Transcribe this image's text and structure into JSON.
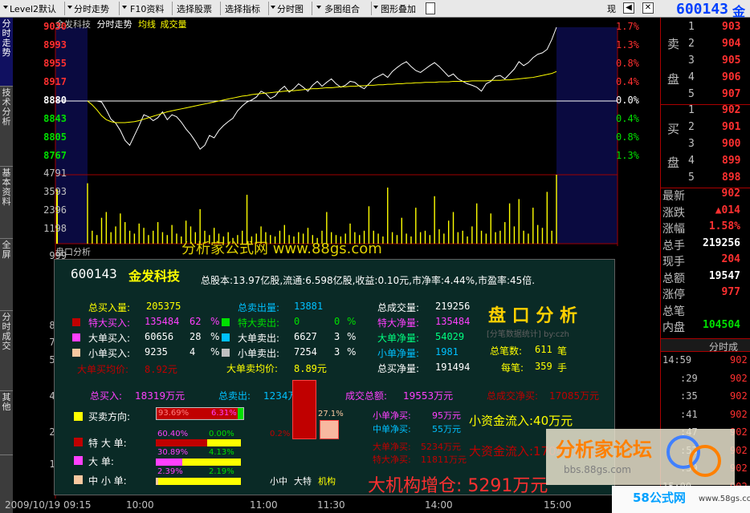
{
  "menubar": {
    "items": [
      "Level2默认",
      "分时走势",
      "F10资料",
      "选择股票",
      "选择指标",
      "分时图",
      "多图组合",
      "图形叠加"
    ],
    "right_item": "现",
    "stock_code": "600143",
    "stock_name_short": "金"
  },
  "left_tabs": [
    "分时走势",
    "技术分析",
    "基本资料",
    "全屏",
    "分时成交",
    "其他"
  ],
  "chart_header": {
    "name": "金发科技",
    "mode": "分时走势",
    "avg": "均线",
    "vol": "成交量"
  },
  "price_axis": {
    "upper": [
      "9030",
      "8993",
      "8955",
      "8917"
    ],
    "mid": "8880",
    "lower": [
      "8843",
      "8805",
      "8767"
    ],
    "pct_up": [
      "1.7%",
      "1.3%",
      "0.8%",
      "0.4%"
    ],
    "pct_mid": "0.0%",
    "pct_down": [
      "0.4%",
      "0.8%",
      "1.3%"
    ],
    "colors": {
      "up": "#ff3030",
      "down": "#00e000",
      "mid": "#ffffff"
    }
  },
  "volume_axis": [
    "4791",
    "3593",
    "2396",
    "1198"
  ],
  "lower_axis": [
    "999",
    "857",
    "714",
    "571",
    "428",
    "286",
    "143"
  ],
  "lower_title": "盘口分析",
  "time_axis": [
    "2009/10/19  09:15",
    "10:00",
    "11:00",
    "11:30",
    "14:00",
    "15:00"
  ],
  "watermark_top": "分析家公式网 www.88gs.com",
  "popup": {
    "code": "600143",
    "name": "金发科技",
    "info": "总股本:13.97亿股,流通:6.598亿股,收益:0.10元,市净率:4.44%,市盈率:45倍.",
    "col1": {
      "total_buy_label": "总买入量:",
      "total_buy": "205375",
      "rows": [
        {
          "label": "特大买入:",
          "value": "135484",
          "pct": "62",
          "unit": "%"
        },
        {
          "label": "大单买入:",
          "value": "60656",
          "pct": "28",
          "unit": "%"
        },
        {
          "label": "小单买入:",
          "value": "9235",
          "pct": "4",
          "unit": "%"
        }
      ],
      "avg_label": "大单买均价:",
      "avg": "8.92元"
    },
    "col2": {
      "total_sell_label": "总卖出量:",
      "total_sell": "13881",
      "rows": [
        {
          "label": "特大卖出:",
          "value": "0",
          "pct": "0",
          "unit": "%"
        },
        {
          "label": "大单卖出:",
          "value": "6627",
          "pct": "3",
          "unit": "%"
        },
        {
          "label": "小单卖出:",
          "value": "7254",
          "pct": "3",
          "unit": "%"
        }
      ],
      "avg_label": "大单卖均价:",
      "avg": "8.89元"
    },
    "col3": {
      "rows": [
        {
          "label": "总成交量:",
          "value": "219256"
        },
        {
          "label": "特大净量:",
          "value": "135484"
        },
        {
          "label": "大单净量:",
          "value": "54029"
        },
        {
          "label": "小单净量:",
          "value": "1981"
        },
        {
          "label": "总买净量:",
          "value": "191494"
        }
      ]
    },
    "analysis": {
      "title": "盘 口 分 析",
      "subtitle": "[分笔数据统计] by:czh",
      "count_label": "总笔数:",
      "count": "611",
      "count_unit": "笔",
      "per_label": "每笔:",
      "per": "359",
      "per_unit": "手"
    },
    "money": {
      "buy_label": "总买入:",
      "buy": "18319万元",
      "sell_label": "总卖出:",
      "sell": "1234万元",
      "total_label": "成交总额:",
      "total": "19553万元",
      "net_label": "总成交净买:",
      "net": "17085万元"
    },
    "bars": [
      {
        "label": "买卖方向:",
        "buy_pct": "93.69%",
        "sell_pct": "6.31%",
        "buy_frac": 0.9369,
        "color": "#ffff00"
      },
      {
        "label": "特 大 单:",
        "buy_pct": "60.40%",
        "sell_pct": "0.00%",
        "buy_frac": 0.604,
        "color": "#c00000"
      },
      {
        "label": "大    单:",
        "buy_pct": "30.89%",
        "sell_pct": "4.13%",
        "buy_frac": 0.3089,
        "color": "#ff40ff"
      },
      {
        "label": "中 小 单:",
        "buy_pct": "2.39%",
        "sell_pct": "2.19%",
        "buy_frac": 0.0239,
        "color": "#f8c8a0"
      }
    ],
    "bigbar": {
      "left_pct": "0.2%",
      "right_pct": "27.1%",
      "left_frac": 0.95,
      "right_frac": 0.271
    },
    "legend": {
      "a": "小中",
      "b": "大特",
      "c": "机构"
    },
    "net": [
      {
        "label": "小单净买:",
        "value": "95万元"
      },
      {
        "label": "中单净买:",
        "value": "55万元"
      },
      {
        "label": "大单净买:",
        "value": "5234万元"
      },
      {
        "label": "特大净买:",
        "value": "11811万元"
      }
    ],
    "small_flow": "小资金流入:40万元",
    "big_flow": "大资金流入:17045万元",
    "inst": "大机构增仓: 5291万元"
  },
  "right_panel": {
    "sell_label": [
      "卖",
      "盘"
    ],
    "buy_label": [
      "买",
      "盘"
    ],
    "sell": [
      {
        "lvl": "5",
        "price": "907"
      },
      {
        "lvl": "4",
        "price": "906"
      },
      {
        "lvl": "3",
        "price": "905"
      },
      {
        "lvl": "2",
        "price": "904"
      },
      {
        "lvl": "1",
        "price": "903"
      }
    ],
    "buy": [
      {
        "lvl": "1",
        "price": "902"
      },
      {
        "lvl": "2",
        "price": "901"
      },
      {
        "lvl": "3",
        "price": "900"
      },
      {
        "lvl": "4",
        "price": "899"
      },
      {
        "lvl": "5",
        "price": "898"
      }
    ],
    "stats": [
      {
        "label": "最新",
        "value": "902",
        "color": "#ff3030"
      },
      {
        "label": "涨跌",
        "value": "▲014",
        "color": "#ff3030"
      },
      {
        "label": "涨幅",
        "value": "1.58%",
        "color": "#ff3030"
      },
      {
        "label": "总手",
        "value": "219256",
        "color": "#ffffff"
      },
      {
        "label": "现手",
        "value": "204",
        "color": "#ff3030"
      },
      {
        "label": "总额",
        "value": "19547",
        "color": "#ffffff"
      },
      {
        "label": "涨停",
        "value": "977",
        "color": "#ff3030"
      },
      {
        "label": "总笔",
        "value": "",
        "color": "#ffffff"
      },
      {
        "label": "内盘",
        "value": "104504",
        "color": "#00e000"
      }
    ],
    "tick_header": "分时成",
    "ticks": [
      {
        "t": "14:59",
        "p": "902"
      },
      {
        "t": ":29",
        "p": "902"
      },
      {
        "t": ":35",
        "p": "902"
      },
      {
        "t": ":41",
        "p": "902"
      },
      {
        "t": ":47",
        "p": "902"
      },
      {
        "t": ":53",
        "p": "902"
      },
      {
        "t": ":59",
        "p": "902"
      },
      {
        "t": "15:00",
        "p": "902"
      }
    ]
  },
  "watermark_forum": {
    "title": "分析家论坛",
    "url": "bbs.88gs.com"
  },
  "watermark_site": {
    "name": "58公式网",
    "url": "www.58gs.com"
  },
  "price_series": [
    8880,
    8880,
    8880,
    8878,
    8862,
    8843,
    8835,
    8820,
    8800,
    8790,
    8810,
    8830,
    8852,
    8848,
    8840,
    8846,
    8858,
    8842,
    8852,
    8848,
    8837,
    8823,
    8812,
    8798,
    8782,
    8790,
    8810,
    8805,
    8820,
    8830,
    8838,
    8845,
    8860,
    8870,
    8878,
    8882,
    8888,
    8900,
    8895,
    8885,
    8890,
    8902,
    8910,
    8898,
    8905,
    8915,
    8908,
    8900,
    8912,
    8920,
    8910,
    8918,
    8925,
    8915,
    8908,
    8912,
    8920,
    8918,
    8910,
    8905,
    8915,
    8925,
    8930,
    8935,
    8928,
    8940,
    8948,
    8955,
    8960,
    8950,
    8942,
    8938,
    8945,
    8952,
    8958,
    8950,
    8940,
    8930,
    8935,
    8925,
    8920,
    8915,
    8912,
    8908,
    8900,
    8915,
    8920,
    8930,
    8932,
    8925,
    8935,
    8945,
    8960,
    8952,
    8958,
    8968,
    8975,
    8978,
    8985,
    9005,
    9030
  ],
  "avg_series": [
    8880,
    8872,
    8862,
    8850,
    8842,
    8838,
    8836,
    8836,
    8836,
    8837,
    8838,
    8840,
    8843,
    8846,
    8849,
    8852,
    8855,
    8858,
    8860,
    8862,
    8864,
    8866,
    8868,
    8870,
    8872,
    8874,
    8876,
    8878,
    8880,
    8882,
    8884,
    8886,
    8888,
    8890,
    8891,
    8893,
    8894,
    8895,
    8896,
    8897,
    8898,
    8899,
    8900,
    8901,
    8901,
    8902,
    8903,
    8904,
    8905,
    8905,
    8906,
    8907,
    8907,
    8908,
    8909,
    8909,
    8910,
    8910,
    8911,
    8911,
    8912,
    8912,
    8913,
    8913,
    8914,
    8914,
    8915,
    8915,
    8916,
    8916,
    8917,
    8917,
    8918,
    8918,
    8918,
    8919,
    8919,
    8919,
    8920,
    8920,
    8920,
    8920,
    8921,
    8921,
    8921,
    8921,
    8922,
    8922,
    8922,
    8923,
    8923,
    8924,
    8925,
    8926,
    8927,
    8928,
    8930,
    8932,
    8934,
    8936,
    8940
  ],
  "volume_series": [
    4200,
    900,
    600,
    1800,
    2200,
    800,
    1200,
    2100,
    1500,
    900,
    700,
    1400,
    1100,
    600,
    900,
    1500,
    800,
    600,
    1300,
    700,
    500,
    1600,
    1200,
    800,
    2400,
    900,
    600,
    1100,
    700,
    500,
    800,
    400,
    600,
    900,
    3400,
    500,
    700,
    1200,
    800,
    600,
    500,
    900,
    1300,
    600,
    500,
    800,
    700,
    1100,
    600,
    400,
    900,
    2200,
    800,
    600,
    500,
    700,
    1400,
    800,
    600,
    900,
    2600,
    900,
    700,
    500,
    3900,
    800,
    600,
    1800,
    700,
    500,
    2500,
    800,
    900,
    600,
    3300,
    1000,
    700,
    1600,
    2200,
    800,
    900,
    500,
    1200,
    2800,
    900,
    700,
    2100,
    800,
    900,
    1500,
    2800,
    1200,
    3100,
    900,
    700,
    2500,
    1300,
    1100,
    3600,
    900,
    4791
  ]
}
